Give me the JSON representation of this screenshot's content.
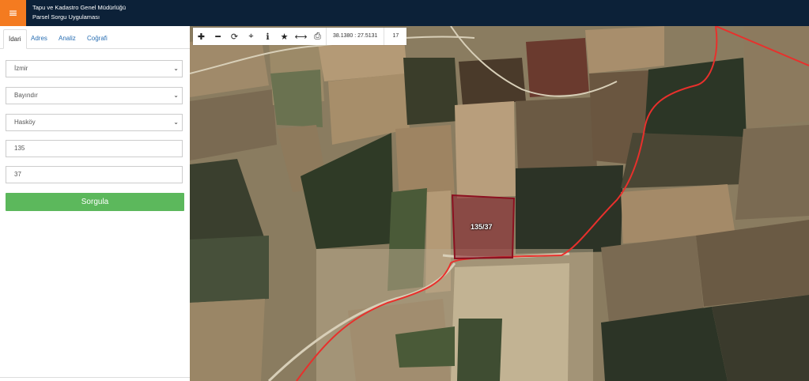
{
  "header": {
    "menu_icon": "≡",
    "title_line1": "Tapu ve Kadastro Genel Müdürlüğü",
    "title_line2": "Parsel Sorgu Uygulaması"
  },
  "sidebar": {
    "tabs": [
      {
        "label": "İdari",
        "active": true
      },
      {
        "label": "Adres",
        "active": false
      },
      {
        "label": "Analiz",
        "active": false
      },
      {
        "label": "Coğrafi",
        "active": false
      }
    ],
    "province": "İzmir",
    "district": "Bayındır",
    "neighborhood": "Hasköy",
    "block": "135",
    "parcel": "37",
    "query_button": "Sorgula"
  },
  "map": {
    "toolbar_icons": [
      "zoom-in-icon",
      "zoom-out-icon",
      "refresh-icon",
      "locate-icon",
      "info-icon",
      "star-icon",
      "measure-icon",
      "print-icon"
    ],
    "coordinates": "38.1380 : 27.5131",
    "zoom_level": "17",
    "parcel_label": "135/37"
  },
  "colors": {
    "header_bg": "#0c2138",
    "menu_btn": "#f47b20",
    "query_btn": "#5cb85c",
    "boundary_line": "#e8302c",
    "parcel_outline": "#8b1020"
  }
}
